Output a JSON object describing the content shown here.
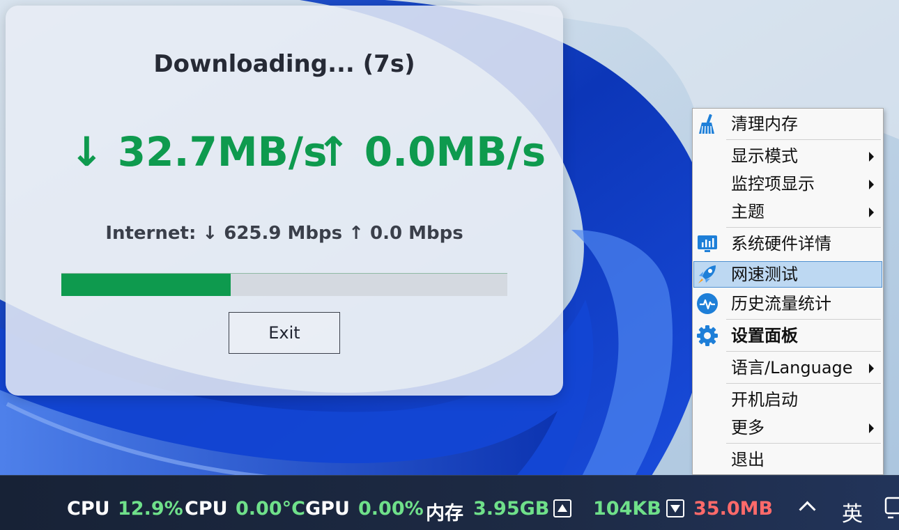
{
  "speed_test": {
    "title": "Downloading... (7s)",
    "download_speed": "↓ 32.7MB/s",
    "upload_speed": "↑ 0.0MB/s",
    "internet_line": "Internet: ↓ 625.9 Mbps   ↑ 0.0 Mbps",
    "progress_fraction": 0.38,
    "exit_label": "Exit"
  },
  "context_menu": {
    "items": [
      {
        "label": "清理内存",
        "icon": "broom-icon"
      },
      {
        "label": "显示模式",
        "submenu": true
      },
      {
        "label": "监控项显示",
        "submenu": true
      },
      {
        "label": "主题",
        "submenu": true
      },
      {
        "label": "系统硬件详情",
        "icon": "hardware-monitor-icon"
      },
      {
        "label": "网速测试",
        "icon": "rocket-icon",
        "highlighted": true
      },
      {
        "label": "历史流量统计",
        "icon": "pulse-icon"
      },
      {
        "label": "设置面板",
        "icon": "gear-icon",
        "bold": true
      },
      {
        "label": "语言/Language",
        "submenu": true
      },
      {
        "label": "开机启动"
      },
      {
        "label": "更多",
        "submenu": true
      },
      {
        "label": "退出"
      }
    ]
  },
  "taskbar": {
    "cpu_label": "CPU",
    "cpu_value": "12.9%",
    "cpu_temp_label": "CPU",
    "cpu_temp_value": "0.00°C",
    "gpu_label": "GPU",
    "gpu_value": "0.00%",
    "mem_label": "内存",
    "mem_value": "3.95GB",
    "upload_value": "104KB",
    "download_value": "35.0MB",
    "ime_label": "英"
  },
  "colors": {
    "accent_green": "#0e9a4e",
    "taskbar_green": "#6fe08a",
    "taskbar_red": "#ff6a6a",
    "menu_highlight": "#bdd8f2"
  }
}
